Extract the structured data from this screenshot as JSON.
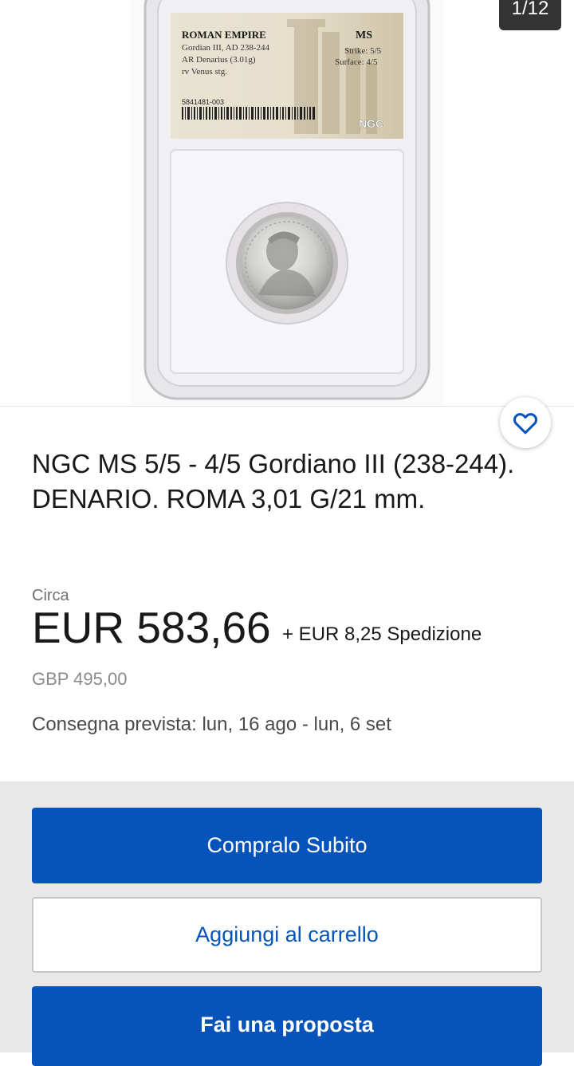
{
  "gallery": {
    "counter": "1/12",
    "label": {
      "line1": "ROMAN EMPIRE",
      "line2": "Gordian III, AD 238-244",
      "line3": "AR Denarius (3.01g)",
      "line4": "rv Venus stg.",
      "grade": "MS",
      "strike": "Strike: 5/5",
      "surface": "Surface: 4/5",
      "cert_number": "5841481-003",
      "brand": "NGC"
    }
  },
  "listing": {
    "title": "NGC MS 5/5 - 4/5 Gordiano III (238-244). DENARIO. ROMA 3,01 G/21 mm.",
    "approx_label": "Circa",
    "price": "EUR 583,66",
    "shipping": "+ EUR 8,25 Spedizione",
    "converted_price": "GBP 495,00",
    "delivery": "Consegna prevista: lun, 16 ago - lun, 6 set"
  },
  "actions": {
    "buy_now": "Compralo Subito",
    "add_to_cart": "Aggiungi al carrello",
    "make_offer": "Fai una proposta"
  },
  "colors": {
    "primary": "#0654ba",
    "text": "#191919",
    "muted": "#707070",
    "action_bg": "#e8e8e8"
  }
}
